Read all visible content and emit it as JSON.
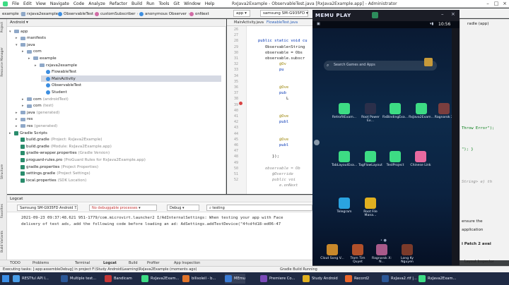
{
  "ide": {
    "menu": [
      "File",
      "Edit",
      "View",
      "Navigate",
      "Code",
      "Analyze",
      "Refactor",
      "Build",
      "Run",
      "Tools",
      "Git",
      "Window",
      "Help"
    ],
    "title": "RxJava2Example - ObservableTest.java [RxJava2Example.app] - Administrator",
    "breadcrumbs": [
      "example",
      "rxjava2example",
      "ObservableTest",
      "customSubscriber",
      "anonymous Observer",
      "onNext"
    ],
    "run_config": "app",
    "device": "samsung SM-G935FD"
  },
  "project": {
    "view": "Android",
    "tree": [
      {
        "label": "app",
        "depth": 0,
        "kind": "folder",
        "expanded": true
      },
      {
        "label": "manifests",
        "depth": 1,
        "kind": "folder"
      },
      {
        "label": "java",
        "depth": 1,
        "kind": "folder",
        "expanded": true
      },
      {
        "label": "com",
        "depth": 2,
        "kind": "folder"
      },
      {
        "label": "example",
        "depth": 3,
        "kind": "folder"
      },
      {
        "label": "rxjava2example",
        "depth": 4,
        "kind": "folder"
      },
      {
        "label": "FlowableTest",
        "depth": 5,
        "kind": "class"
      },
      {
        "label": "MainActivity",
        "depth": 5,
        "kind": "class",
        "selected": true
      },
      {
        "label": "ObservableTest",
        "depth": 5,
        "kind": "class"
      },
      {
        "label": "Student",
        "depth": 5,
        "kind": "class"
      },
      {
        "label": "com",
        "suffix": "(androidTest)",
        "depth": 2,
        "kind": "folder"
      },
      {
        "label": "com",
        "suffix": "(test)",
        "depth": 2,
        "kind": "folder"
      },
      {
        "label": "java",
        "suffix": "(generated)",
        "depth": 1,
        "kind": "folder"
      },
      {
        "label": "res",
        "depth": 1,
        "kind": "folder"
      },
      {
        "label": "res",
        "suffix": "(generated)",
        "depth": 1,
        "kind": "folder"
      },
      {
        "label": "Gradle Scripts",
        "depth": 0,
        "kind": "gradle-root"
      },
      {
        "label": "build.gradle",
        "suffix": "(Project: RxJava2Example)",
        "depth": 1,
        "kind": "gradle"
      },
      {
        "label": "build.gradle",
        "suffix": "(Module: RxJava2Example.app)",
        "depth": 1,
        "kind": "gradle"
      },
      {
        "label": "gradle-wrapper.properties",
        "suffix": "(Gradle Version)",
        "depth": 1,
        "kind": "gradle"
      },
      {
        "label": "proguard-rules.pro",
        "suffix": "(ProGuard Rules for RxJava2Example.app)",
        "depth": 1,
        "kind": "gradle"
      },
      {
        "label": "gradle.properties",
        "suffix": "(Project Properties)",
        "depth": 1,
        "kind": "gradle"
      },
      {
        "label": "settings.gradle",
        "suffix": "(Project Settings)",
        "depth": 1,
        "kind": "gradle"
      },
      {
        "label": "local.properties",
        "suffix": "(SDK Location)",
        "depth": 1,
        "kind": "gradle"
      }
    ]
  },
  "editor": {
    "tabs": [
      "MainActivity.java",
      "FlowableTest.java"
    ],
    "line_numbers": [
      "26",
      "27",
      "28",
      "29",
      "30",
      "31",
      "32",
      "33",
      "34",
      "35",
      "36",
      "37",
      "38",
      "39",
      "40",
      "41",
      "42",
      "43",
      "44",
      "45",
      "46",
      "47",
      "48",
      "49",
      "50",
      "51",
      "52"
    ],
    "lines": [
      {
        "text": "public static void cu",
        "cls": "kw",
        "indent": 0
      },
      {
        "text": "Observable<String",
        "cls": "",
        "indent": 1
      },
      {
        "text": "observable = Obs",
        "cls": "",
        "indent": 1
      },
      {
        "text": "observable.subscr",
        "cls": "",
        "indent": 1
      },
      {
        "text": "@Ov",
        "cls": "ann",
        "indent": 3
      },
      {
        "text": "pu",
        "cls": "kw",
        "indent": 3
      },
      {
        "text": "",
        "cls": "",
        "indent": 3
      },
      {
        "text": "",
        "cls": "",
        "indent": 3
      },
      {
        "text": "@Ove",
        "cls": "ann",
        "indent": 3
      },
      {
        "text": "pub",
        "cls": "kw",
        "indent": 3
      },
      {
        "text": "L",
        "cls": "",
        "indent": 4
      },
      {
        "text": "",
        "cls": "",
        "indent": 3
      },
      {
        "text": "",
        "cls": "",
        "indent": 3
      },
      {
        "text": "@Ove",
        "cls": "ann",
        "indent": 3
      },
      {
        "text": "publ",
        "cls": "kw",
        "indent": 3
      },
      {
        "text": "",
        "cls": "",
        "indent": 3
      },
      {
        "text": "",
        "cls": "",
        "indent": 3
      },
      {
        "text": "@Ove",
        "cls": "ann",
        "indent": 3
      },
      {
        "text": "publ",
        "cls": "kw",
        "indent": 3
      },
      {
        "text": "",
        "cls": "",
        "indent": 3
      },
      {
        "text": "});",
        "cls": "",
        "indent": 2
      },
      {
        "text": "",
        "cls": "",
        "indent": 0
      },
      {
        "text": "observable = Ob",
        "cls": "cmt",
        "indent": 1
      },
      {
        "text": "@Override",
        "cls": "cmt",
        "indent": 2
      },
      {
        "text": "public voi",
        "cls": "cmt",
        "indent": 2
      },
      {
        "text": "e.onNext",
        "cls": "cmt",
        "indent": 3
      }
    ]
  },
  "right_ide": {
    "snippets": [
      "radle (app)",
      "Throw Error\");",
      "\"); }",
      "String> e) th",
      "ensure the",
      "application",
      "i Patch 2 avai",
      "Layout Inspector"
    ]
  },
  "logcat": {
    "title": "Logcat",
    "device": "Samsung SM-G935FD  Android 7.",
    "process": "No debuggable processes",
    "level": "Debug",
    "search": "testing",
    "lines": [
      "2021-09-23 09:37:48.621 951-1779/com.microvirt.launcher2 I/AdInternalSettings: When testing your app with Face",
      "    delivery of test ads, add the following code before loading an ad: AdSettings.addTestDevice(\"4fcdfd18-ed06-47"
    ]
  },
  "tool_tabs": [
    "TODO",
    "Problems",
    "Terminal",
    "Logcat",
    "Build",
    "Profiler",
    "App Inspection"
  ],
  "status": {
    "message": "Executing tasks: [:app:assembleDebug] in project F:\\Study Android\\Learning\\RxJava2Example (moments ago)",
    "right": "Gradle Build Running"
  },
  "memu": {
    "logo": "MEMU PLAY",
    "time": "10:56",
    "search_placeholder": "Search Games and Apps",
    "apps_row1": [
      "RetrofitExam...",
      "Root Power Ex...",
      "RxBindingExa...",
      "RxJava2Exam...",
      "Ragnarok X"
    ],
    "apps_row2": [
      "TabLayoutExa...",
      "TagFlowLayout",
      "TestProject",
      "Chinese Link"
    ],
    "apps_row3": [
      "Telegram",
      "Root File Mana..."
    ],
    "dock": [
      "Clout Song V...",
      "Trom Tim Quyet",
      "Ragnarok X: N...",
      "Long Ky Nguyen"
    ]
  },
  "taskbar": {
    "items": [
      "RESTful API I...",
      "Multiple test...",
      "Bandicam",
      "RxJava2Exam...",
      "bilisoleil - b...",
      "MEmu",
      "Premiere Co...",
      "Study Android",
      "Record2",
      "RxJava2.rtf |...",
      "RxJava2Exam..."
    ]
  }
}
